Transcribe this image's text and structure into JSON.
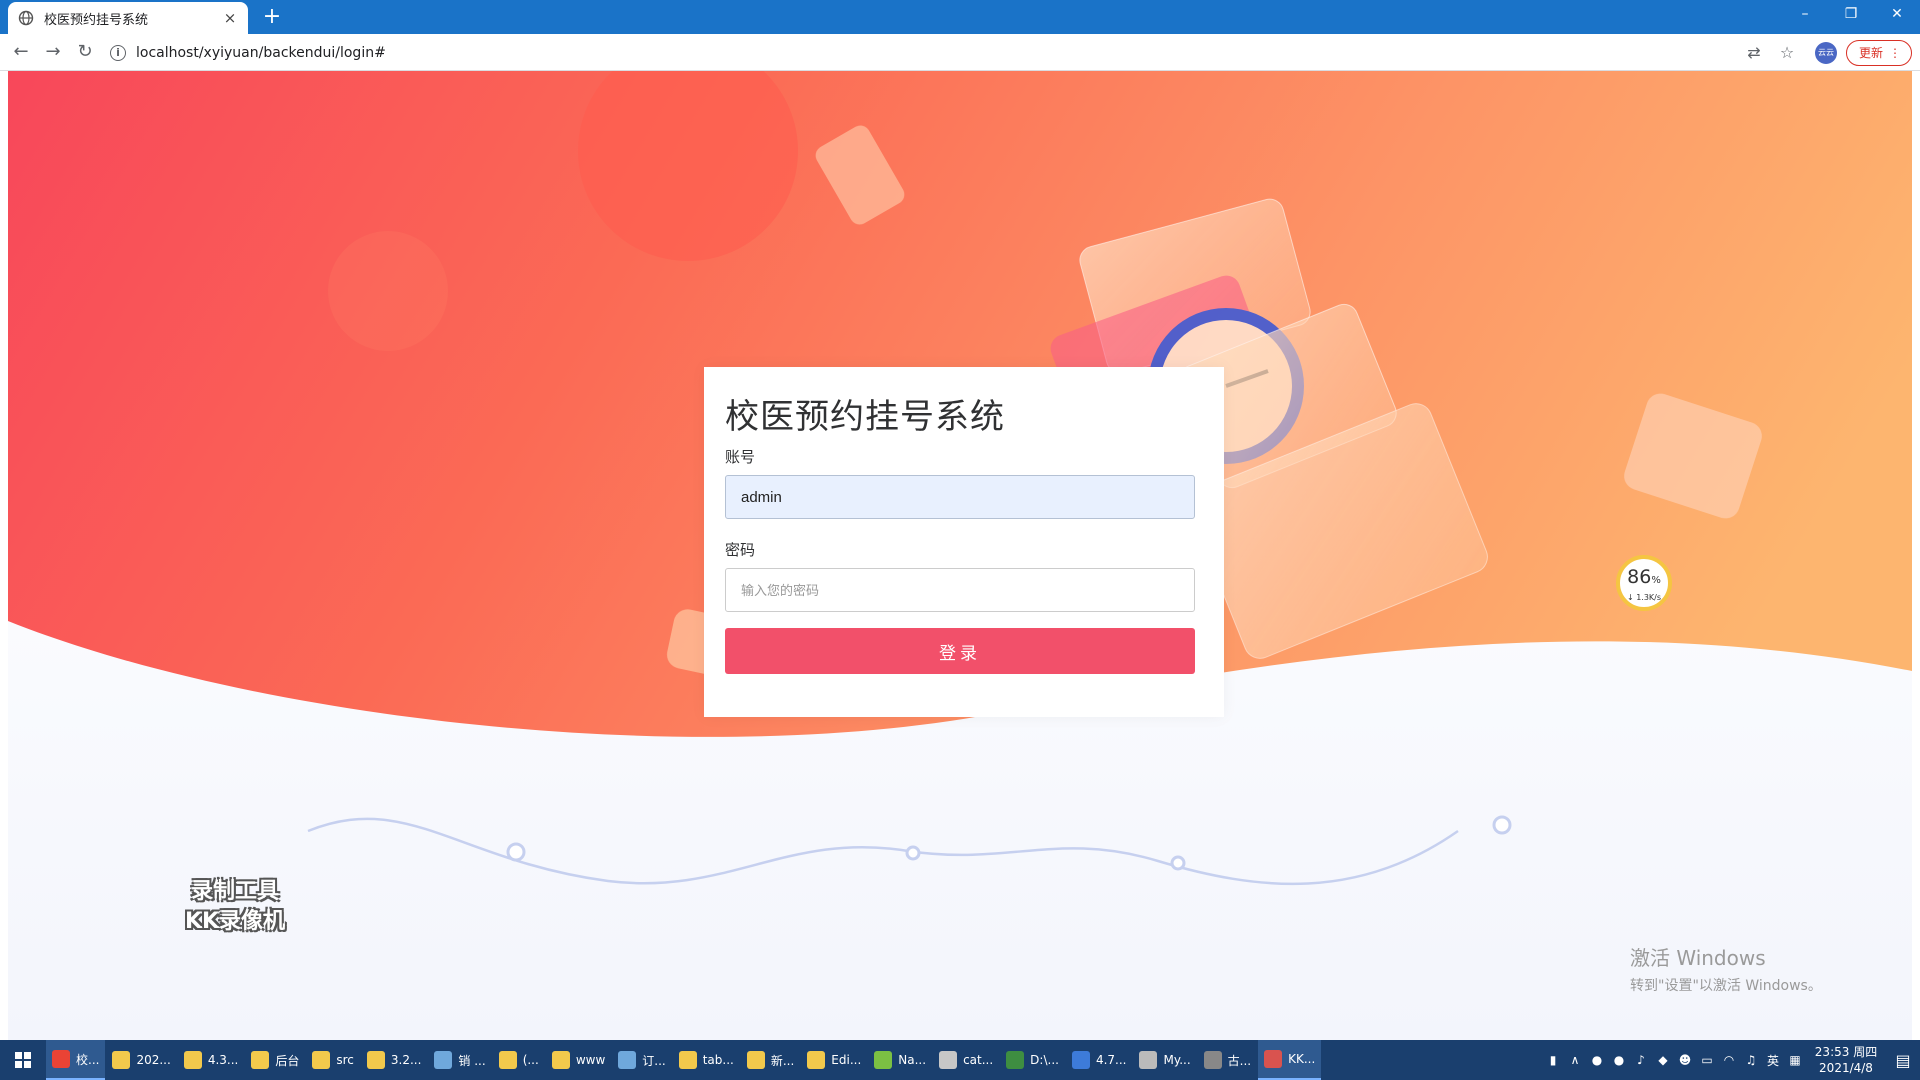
{
  "browser": {
    "tab_title": "校医预约挂号系统",
    "tab_close": "×",
    "new_tab": "+",
    "url": "localhost/xyiyuan/backendui/login#",
    "update_label": "更新",
    "update_more": "⋮",
    "profile_label": "云云"
  },
  "login": {
    "title": "校医预约挂号系统",
    "account_label": "账号",
    "account_value": "admin",
    "password_label": "密码",
    "password_placeholder": "输入您的密码",
    "submit_label": "登录"
  },
  "speed_widget": {
    "percent": "86",
    "percent_unit": "%",
    "rate": "↓ 1.3K/s"
  },
  "overlays": {
    "rec_line1": "录制工具",
    "rec_line2": "KK录像机",
    "activate_title": "激活 Windows",
    "activate_sub": "转到\"设置\"以激活 Windows。"
  },
  "taskbar": {
    "items": [
      {
        "label": "校...",
        "color": "#ea4335",
        "active": true
      },
      {
        "label": "202...",
        "color": "#f2c94c"
      },
      {
        "label": "4.3...",
        "color": "#f2c94c"
      },
      {
        "label": "后台",
        "color": "#f2c94c"
      },
      {
        "label": "src",
        "color": "#f2c94c"
      },
      {
        "label": "3.2...",
        "color": "#f2c94c"
      },
      {
        "label": "销 ...",
        "color": "#6fa8dc"
      },
      {
        "label": "(...",
        "color": "#f2c94c"
      },
      {
        "label": "www",
        "color": "#f2c94c"
      },
      {
        "label": "订...",
        "color": "#6fa8dc"
      },
      {
        "label": "tab...",
        "color": "#f2c94c"
      },
      {
        "label": "新...",
        "color": "#f2c94c"
      },
      {
        "label": "Edi...",
        "color": "#f2c94c"
      },
      {
        "label": "Na...",
        "color": "#7bc043"
      },
      {
        "label": "cat...",
        "color": "#c7c7c7"
      },
      {
        "label": "D:\\...",
        "color": "#3e8e41"
      },
      {
        "label": "4.7...",
        "color": "#3d7bd9"
      },
      {
        "label": "My...",
        "color": "#bbbbbb"
      },
      {
        "label": "古...",
        "color": "#888888"
      },
      {
        "label": "KK...",
        "color": "#d9534f",
        "active": true
      }
    ],
    "tray_lang": "英",
    "time": "23:53 周四",
    "date": "2021/4/8"
  }
}
